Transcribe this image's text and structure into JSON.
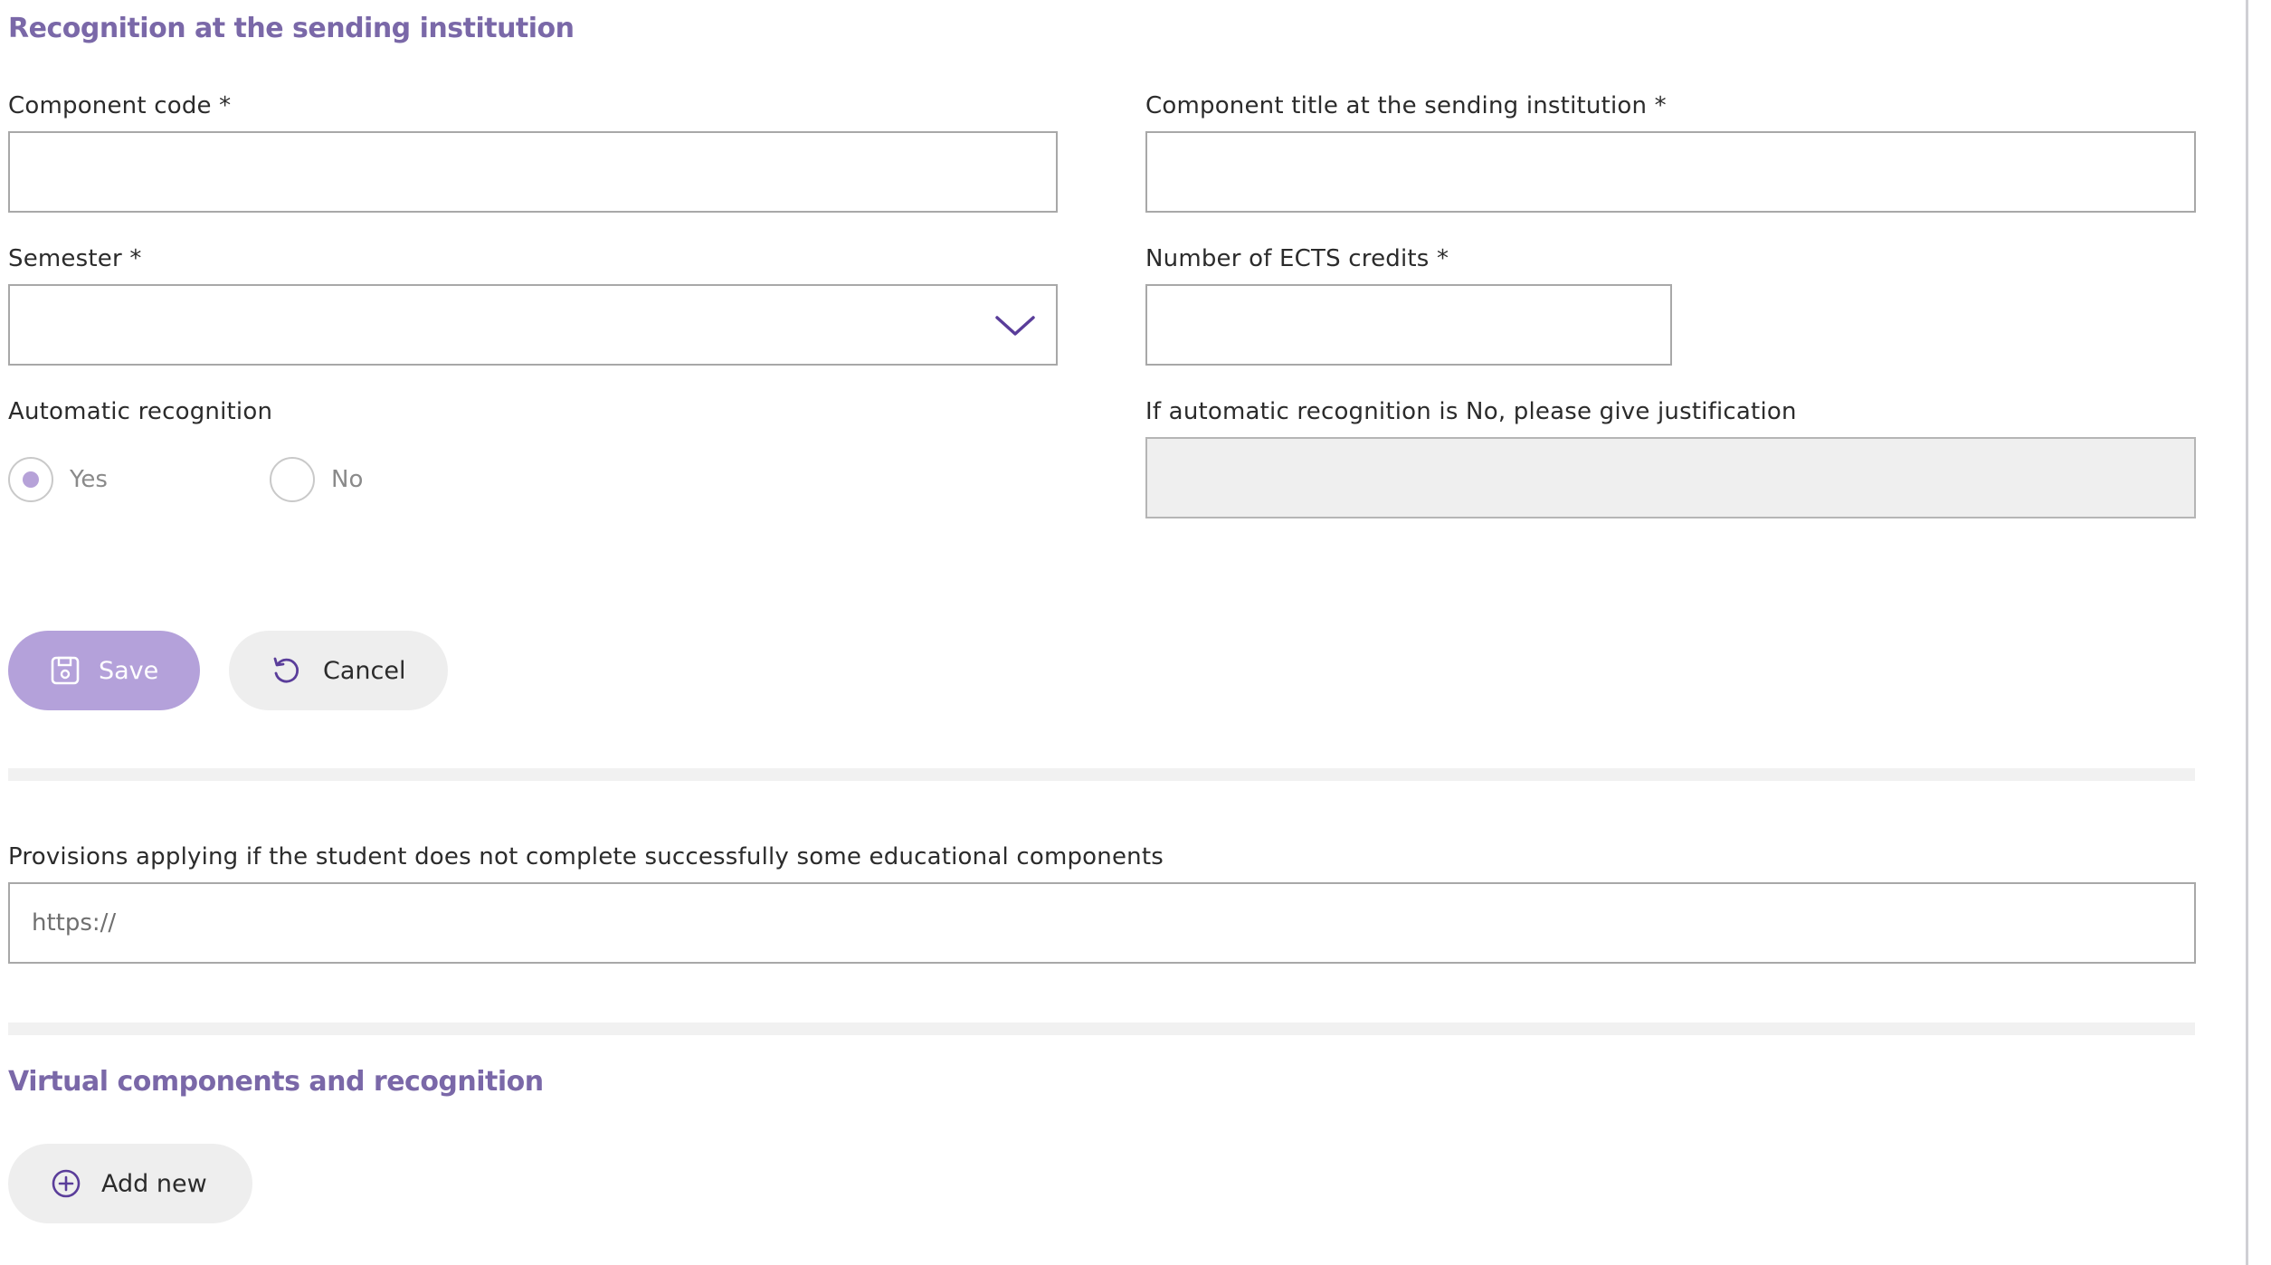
{
  "recognition": {
    "title": "Recognition at the sending institution",
    "component_code": {
      "label": "Component code *",
      "value": ""
    },
    "component_title": {
      "label": "Component title at the sending institution *",
      "value": ""
    },
    "semester": {
      "label": "Semester *",
      "selected": ""
    },
    "ects": {
      "label": "Number of ECTS credits *",
      "value": ""
    },
    "automatic_recognition": {
      "label": "Automatic recognition",
      "options": [
        {
          "label": "Yes",
          "selected": true
        },
        {
          "label": "No",
          "selected": false
        }
      ]
    },
    "justification": {
      "label": "If automatic recognition is No, please give justification",
      "value": ""
    },
    "actions": {
      "save_label": "Save",
      "cancel_label": "Cancel"
    }
  },
  "provisions": {
    "label": "Provisions applying if the student does not complete successfully some educational components",
    "placeholder": "https://"
  },
  "virtual": {
    "title": "Virtual components and recognition",
    "add_new_label": "Add new"
  },
  "colors": {
    "accent": "#7a68a8",
    "primary_button": "#b4a1da",
    "icon": "#5a3d9a"
  },
  "icons": {
    "semester_chevron": "chevron-down-icon",
    "save": "save-icon",
    "cancel": "undo-icon",
    "add_new": "plus-circle-icon"
  }
}
